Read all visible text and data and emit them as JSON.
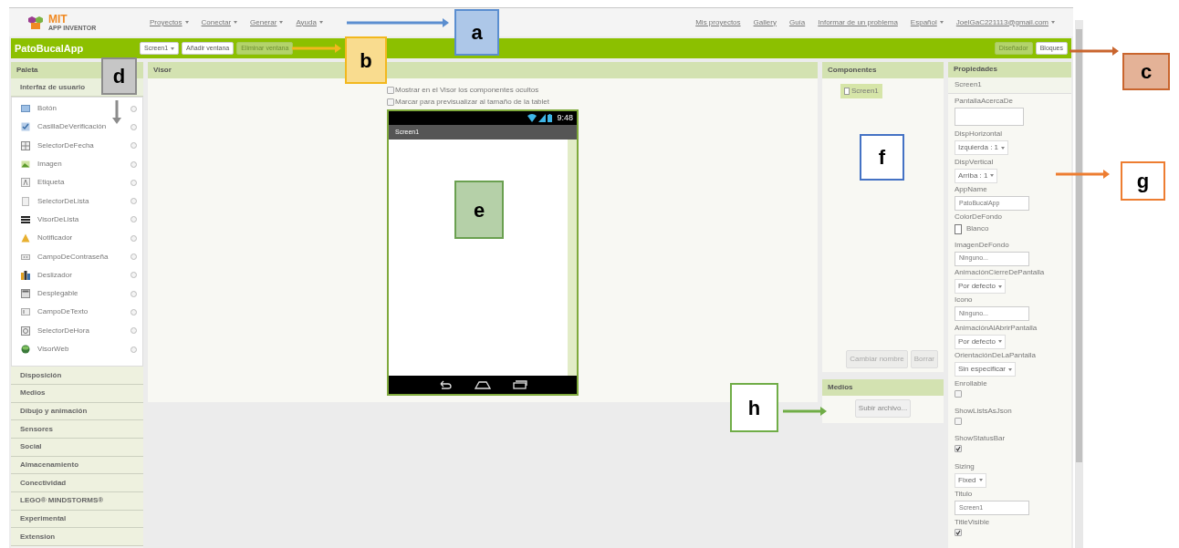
{
  "top_nav": {
    "logo": {
      "title": "MIT",
      "subtitle": "APP INVENTOR"
    },
    "menus": [
      {
        "label": "Proyectos",
        "dropdown": true
      },
      {
        "label": "Conectar",
        "dropdown": true
      },
      {
        "label": "Generar",
        "dropdown": true
      },
      {
        "label": "Ayuda",
        "dropdown": true
      }
    ],
    "links": [
      {
        "label": "Mis proyectos",
        "dropdown": false
      },
      {
        "label": "Gallery",
        "dropdown": false
      },
      {
        "label": "Guía",
        "dropdown": false
      },
      {
        "label": "Informar de un problema",
        "dropdown": false
      },
      {
        "label": "Español",
        "dropdown": true
      },
      {
        "label": "JoelGaC221113@gmail.com",
        "dropdown": true
      }
    ]
  },
  "project_bar": {
    "project_name": "PatoBucalApp",
    "screen_selector": "Screen1",
    "buttons": [
      {
        "label": "Añadir ventana",
        "disabled": false
      },
      {
        "label": "Eliminar ventana",
        "disabled": true
      }
    ],
    "views": [
      {
        "label": "Diseñador",
        "selected": true
      },
      {
        "label": "Bloques",
        "selected": false
      }
    ]
  },
  "palette": {
    "title": "Paleta",
    "open_category": "Interfaz de usuario",
    "items": [
      "Botón",
      "CasillaDeVerificación",
      "SelectorDeFecha",
      "Imagen",
      "Etiqueta",
      "SelectorDeLista",
      "VisorDeLista",
      "Notificador",
      "CampoDeContraseña",
      "Deslizador",
      "Desplegable",
      "CampoDeTexto",
      "SelectorDeHora",
      "VisorWeb"
    ],
    "categories": [
      "Disposición",
      "Medios",
      "Dibujo y animación",
      "Sensores",
      "Social",
      "Almacenamiento",
      "Conectividad",
      "LEGO® MINDSTORMS®",
      "Experimental",
      "Extension"
    ]
  },
  "viewer": {
    "title": "Visor",
    "options": [
      {
        "label": "Mostrar en el Visor los componentes ocultos",
        "checked": false
      },
      {
        "label": "Marcar para previsualizar al tamaño de la tablet",
        "checked": false
      }
    ],
    "phone": {
      "time": "9:48",
      "screen_title": "Screen1"
    }
  },
  "components": {
    "title": "Componentes",
    "tree": [
      {
        "label": "Screen1",
        "selected": true
      }
    ],
    "buttons": [
      {
        "label": "Cambiar nombre",
        "disabled": true
      },
      {
        "label": "Borrar",
        "disabled": true
      }
    ]
  },
  "media": {
    "title": "Medios",
    "upload_button": "Subir archivo..."
  },
  "properties": {
    "title": "Propiedades",
    "component": "Screen1",
    "items": [
      {
        "kind": "textarea",
        "label": "PantallaAcercaDe"
      },
      {
        "kind": "dropdown",
        "label": "DispHorizontal",
        "value": "Izquierda : 1"
      },
      {
        "kind": "dropdown",
        "label": "DispVertical",
        "value": "Arriba : 1"
      },
      {
        "kind": "text",
        "label": "AppName",
        "value": "PatoBucalApp"
      },
      {
        "kind": "color",
        "label": "ColorDeFondo",
        "value": "Blanco"
      },
      {
        "kind": "text",
        "label": "ImagenDeFondo",
        "value": "Ninguno..."
      },
      {
        "kind": "dropdown",
        "label": "AnimaciónCierreDePantalla",
        "value": "Por defecto"
      },
      {
        "kind": "text",
        "label": "Icono",
        "value": "Ninguno..."
      },
      {
        "kind": "dropdown",
        "label": "AnimaciónAlAbrirPantalla",
        "value": "Por defecto"
      },
      {
        "kind": "dropdown",
        "label": "OrientaciónDeLaPantalla",
        "value": "Sin especificar"
      },
      {
        "kind": "checkbox",
        "label": "Enrollable",
        "checked": false
      },
      {
        "kind": "checkbox",
        "label": "ShowListsAsJson",
        "checked": false
      },
      {
        "kind": "checkbox",
        "label": "ShowStatusBar",
        "checked": true
      },
      {
        "kind": "dropdown",
        "label": "Sizing",
        "value": "Fixed"
      },
      {
        "kind": "text",
        "label": "Titulo",
        "value": "Screen1"
      },
      {
        "kind": "checkbox",
        "label": "TitleVisible",
        "checked": true
      }
    ]
  },
  "annotations": [
    {
      "label": "a",
      "color": "#5b8ed0",
      "filled": true,
      "arrow": true
    },
    {
      "label": "b",
      "color": "#f2b81e",
      "filled": true,
      "arrow": true
    },
    {
      "label": "c",
      "color": "#c9652e",
      "filled": true,
      "arrow": true
    },
    {
      "label": "d",
      "color": "#8c8c8c",
      "filled": true,
      "arrow": true
    },
    {
      "label": "e",
      "color": "#6aa050",
      "filled": true,
      "arrow": false
    },
    {
      "label": "f",
      "color": "#4472c4",
      "filled": false,
      "arrow": false
    },
    {
      "label": "g",
      "color": "#ed7d31",
      "filled": false,
      "arrow": true
    },
    {
      "label": "h",
      "color": "#70ad47",
      "filled": false,
      "arrow": true
    }
  ]
}
